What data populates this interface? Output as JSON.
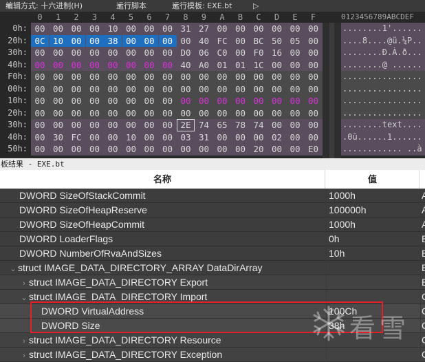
{
  "toolbar": {
    "edit_mode": "编辑方式: 十六进制(H)",
    "run_script": "运行脚本",
    "run_template": "运行模板: EXE.bt",
    "play_glyph": "▷"
  },
  "hex": {
    "columns": [
      "0",
      "1",
      "2",
      "3",
      "4",
      "5",
      "6",
      "7",
      "8",
      "9",
      "A",
      "B",
      "C",
      "D",
      "E",
      "F"
    ],
    "ascii_header": "0123456789ABCDEF",
    "rows": [
      {
        "offset": "0h:",
        "bytes": [
          "00",
          "00",
          "00",
          "00",
          "10",
          "00",
          "00",
          "00",
          "31",
          "27",
          "00",
          "00",
          "00",
          "00",
          "00",
          "00"
        ],
        "ascii": "........1'......"
      },
      {
        "offset": "20h:",
        "bytes": [
          "0C",
          "10",
          "00",
          "00",
          "38",
          "00",
          "00",
          "00",
          "00",
          "40",
          "FC",
          "00",
          "BC",
          "50",
          "05",
          "00"
        ],
        "ascii": "....8....@ü.¼P.."
      },
      {
        "offset": "30h:",
        "bytes": [
          "00",
          "00",
          "00",
          "00",
          "00",
          "00",
          "00",
          "00",
          "D0",
          "06",
          "C0",
          "00",
          "F0",
          "16",
          "00",
          "00"
        ],
        "ascii": "........Ð.À.ð..."
      },
      {
        "offset": "40h:",
        "bytes": [
          "00",
          "00",
          "00",
          "00",
          "00",
          "00",
          "00",
          "00",
          "40",
          "A0",
          "01",
          "01",
          "1C",
          "00",
          "00",
          "00"
        ],
        "ascii": "........@ ......"
      },
      {
        "offset": "F0h:",
        "bytes": [
          "00",
          "00",
          "00",
          "00",
          "00",
          "00",
          "00",
          "00",
          "00",
          "00",
          "00",
          "00",
          "00",
          "00",
          "00",
          "00"
        ],
        "ascii": "................"
      },
      {
        "offset": "00h:",
        "bytes": [
          "00",
          "00",
          "00",
          "00",
          "00",
          "00",
          "00",
          "00",
          "00",
          "00",
          "00",
          "00",
          "00",
          "00",
          "00",
          "00"
        ],
        "ascii": "................"
      },
      {
        "offset": "10h:",
        "bytes": [
          "00",
          "00",
          "00",
          "00",
          "00",
          "00",
          "00",
          "00",
          "00",
          "00",
          "00",
          "00",
          "00",
          "00",
          "00",
          "00"
        ],
        "ascii": "................"
      },
      {
        "offset": "20h:",
        "bytes": [
          "00",
          "00",
          "00",
          "00",
          "00",
          "00",
          "00",
          "00",
          "00",
          "00",
          "00",
          "00",
          "00",
          "00",
          "00",
          "00"
        ],
        "ascii": "................"
      },
      {
        "offset": "30h:",
        "bytes": [
          "00",
          "00",
          "00",
          "00",
          "00",
          "00",
          "00",
          "00",
          "2E",
          "74",
          "65",
          "78",
          "74",
          "00",
          "00",
          "00"
        ],
        "ascii": "........text...."
      },
      {
        "offset": "40h:",
        "bytes": [
          "00",
          "30",
          "FC",
          "00",
          "00",
          "10",
          "00",
          "00",
          "03",
          "31",
          "00",
          "00",
          "00",
          "02",
          "00",
          "00"
        ],
        "ascii": ".0ü......1......"
      },
      {
        "offset": "50h:",
        "bytes": [
          "00",
          "00",
          "00",
          "00",
          "00",
          "00",
          "00",
          "00",
          "00",
          "00",
          "00",
          "00",
          "20",
          "00",
          "00",
          "E0"
        ],
        "ascii": "............ ..à"
      }
    ]
  },
  "results": {
    "title": "板结果 - EXE.bt",
    "header_name": "名称",
    "header_value": "值",
    "rows": [
      {
        "name": "DWORD SizeOfStackCommit",
        "value": "1000h",
        "extra": "A"
      },
      {
        "name": "DWORD SizeOfHeapReserve",
        "value": "100000h",
        "extra": "A"
      },
      {
        "name": "DWORD SizeOfHeapCommit",
        "value": "1000h",
        "extra": "A"
      },
      {
        "name": "DWORD LoaderFlags",
        "value": "0h",
        "extra": "B"
      },
      {
        "name": "DWORD NumberOfRvaAndSizes",
        "value": "10h",
        "extra": "B"
      },
      {
        "name": "struct IMAGE_DATA_DIRECTORY_ARRAY DataDirArray",
        "value": "",
        "extra": "B"
      },
      {
        "name": "struct IMAGE_DATA_DIRECTORY Export",
        "value": "",
        "extra": "B"
      },
      {
        "name": "struct IMAGE_DATA_DIRECTORY Import",
        "value": "",
        "extra": "C"
      },
      {
        "name": "DWORD VirtualAddress",
        "value": "100Ch",
        "extra": "C"
      },
      {
        "name": "DWORD Size",
        "value": "38h",
        "extra": "C"
      },
      {
        "name": "struct IMAGE_DATA_DIRECTORY Resource",
        "value": "",
        "extra": "C"
      },
      {
        "name": "struct IMAGE_DATA_DIRECTORY Exception",
        "value": "",
        "extra": "C"
      }
    ]
  },
  "watermark": {
    "logo_icon": "snowflake-icon",
    "text": "看雪"
  },
  "colors": {
    "selection": "#1e6fc0",
    "highlight_box": "#e0202a",
    "pink_bytes": "#d832d8"
  }
}
